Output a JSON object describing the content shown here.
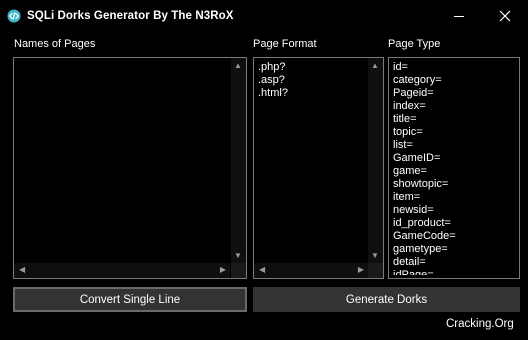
{
  "window": {
    "title": "SQLi Dorks Generator By The N3RoX",
    "minimize_glyph": "minimize-icon",
    "close_glyph": "close-icon"
  },
  "labels": {
    "names_of_pages": "Names of Pages",
    "page_format": "Page Format",
    "page_type": "Page Type"
  },
  "page_format": [
    ".php?",
    ".asp?",
    ".html?"
  ],
  "page_type": [
    "id=",
    "category=",
    "Pageid=",
    "index=",
    "title=",
    "topic=",
    "list=",
    "GameID=",
    "game=",
    "showtopic=",
    "item=",
    "newsid=",
    "id_product=",
    "GameCode=",
    "gametype=",
    "detail=",
    "idPage="
  ],
  "buttons": {
    "convert": "Convert Single Line",
    "generate": "Generate Dorks"
  },
  "footer": {
    "credit": "Cracking.Org"
  },
  "colors": {
    "background": "#000000",
    "button": "#333333",
    "border": "#7a7a7a",
    "icon_accent": "#3fb7c9"
  }
}
